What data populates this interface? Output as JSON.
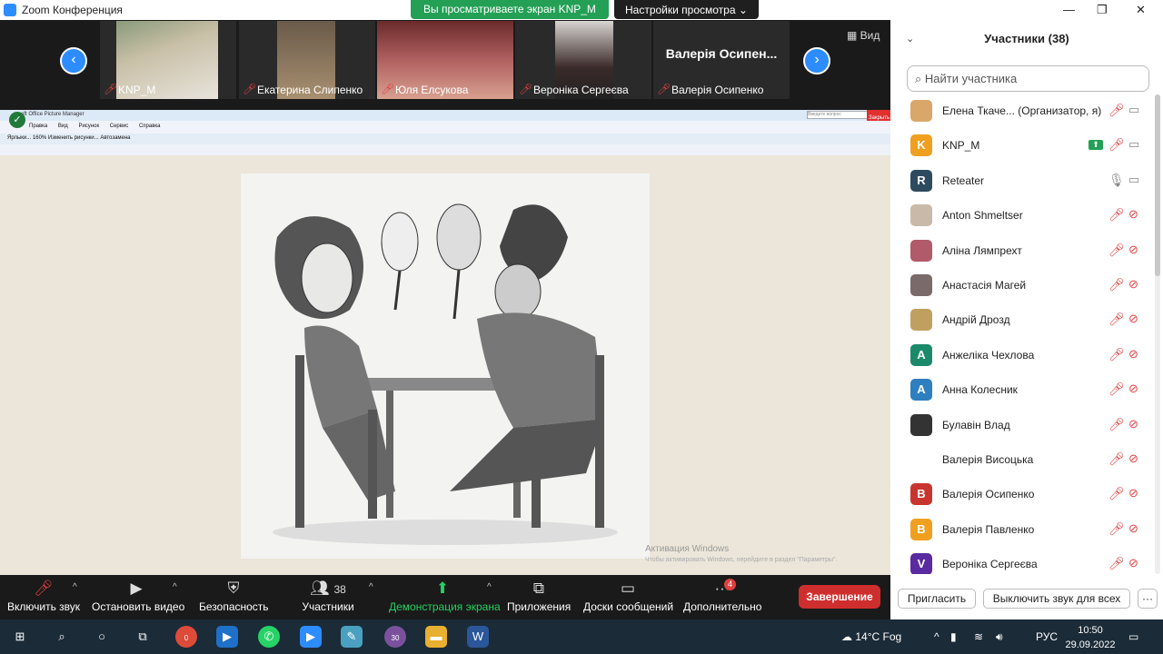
{
  "window": {
    "title": "Zoom Конференция",
    "minimize": "—",
    "maximize": "❐",
    "close": "✕"
  },
  "share_banner": "Вы просматриваете экран KNP_M",
  "view_settings": "Настройки просмотра ⌄",
  "view_label": "Вид",
  "gallery": {
    "prev": "‹",
    "next": "›",
    "tiles": [
      {
        "name": "KNP_M"
      },
      {
        "name": "Екатерина Слипенко"
      },
      {
        "name": "Юля Елсукова"
      },
      {
        "name": "Вероніка Сергеєва"
      },
      {
        "name": "Валерія Осипенко",
        "big": "Валерія  Осипен..."
      }
    ]
  },
  "shared_app": {
    "title": "soft Office Picture Manager",
    "menu": "Правка Вид Рисунок Сервис Справка",
    "tools": "Ярлыки...     160%     Изменить рисунки...     Автозамена",
    "close_btn": "Закрыть",
    "search_ph": "Введите вопрос"
  },
  "watermark": {
    "line1": "Активация Windows",
    "line2": "Чтобы активировать Windows, перейдите в раздел \"Параметры\"."
  },
  "toolbar": {
    "audio": "Включить звук",
    "video": "Остановить видео",
    "security": "Безопасность",
    "participants": "Участники",
    "participants_count": "38",
    "share": "Демонстрация экрана",
    "apps": "Приложения",
    "whiteboard": "Доски сообщений",
    "more": "Дополнительно",
    "more_badge": "4",
    "end": "Завершение"
  },
  "panel": {
    "title": "Участники (38)",
    "search_placeholder": "Найти участника",
    "participants": [
      {
        "name": "Елена Ткаче...  (Организатор, я)",
        "avatar": "",
        "color": "#d9a76a",
        "mic": "muted",
        "cam": "on"
      },
      {
        "name": "KNP_M",
        "avatar": "K",
        "color": "#f0a020",
        "mic": "muted",
        "cam": "on",
        "sharing": true
      },
      {
        "name": "Reteater",
        "avatar": "R",
        "color": "#2e4a5e",
        "mic": "on",
        "cam": "on"
      },
      {
        "name": "Anton Shmeltser",
        "avatar": "",
        "color": "#c9b9a9",
        "mic": "muted",
        "cam": "off"
      },
      {
        "name": "Аліна Лямпрехт",
        "avatar": "",
        "color": "#b05a6a",
        "mic": "muted",
        "cam": "off"
      },
      {
        "name": "Анастасія Магей",
        "avatar": "",
        "color": "#7a6a6a",
        "mic": "muted",
        "cam": "off"
      },
      {
        "name": "Андрій Дрозд",
        "avatar": "",
        "color": "#c0a060",
        "mic": "muted",
        "cam": "off"
      },
      {
        "name": "Анжеліка Чехлова",
        "avatar": "A",
        "color": "#1a8a6a",
        "mic": "muted",
        "cam": "off"
      },
      {
        "name": "Анна Колесник",
        "avatar": "A",
        "color": "#2e7fc0",
        "mic": "muted",
        "cam": "off"
      },
      {
        "name": "Булавін Влад",
        "avatar": "",
        "color": "#333333",
        "mic": "muted",
        "cam": "off"
      },
      {
        "name": "Валерія Висоцька",
        "avatar": "",
        "color": "#ffffff",
        "mic": "muted",
        "cam": "off"
      },
      {
        "name": "Валерія Осипенко",
        "avatar": "B",
        "color": "#c8352e",
        "mic": "muted",
        "cam": "off"
      },
      {
        "name": "Валерія Павленко",
        "avatar": "B",
        "color": "#f0a020",
        "mic": "muted",
        "cam": "off"
      },
      {
        "name": "Вероніка Сергеєва",
        "avatar": "V",
        "color": "#5a2aa0",
        "mic": "muted",
        "cam": "off"
      }
    ],
    "invite": "Пригласить",
    "mute_all": "Выключить звук для всех",
    "more": "···"
  },
  "taskbar": {
    "weather": "14°C  Fog",
    "lang": "РУС",
    "time": "10:50",
    "date": "29.09.2022",
    "viber_badge": "30",
    "chrome_badge": "0"
  }
}
